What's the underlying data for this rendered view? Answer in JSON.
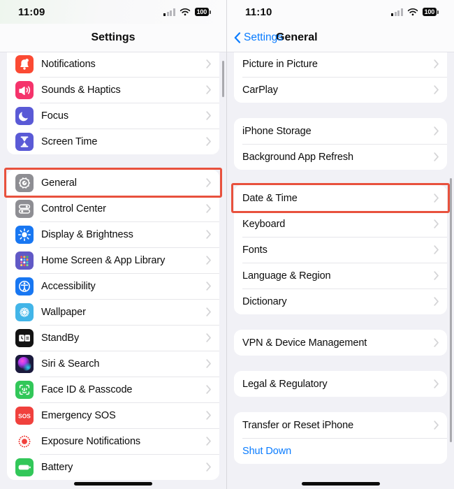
{
  "left": {
    "status": {
      "time": "11:09",
      "battery": "100",
      "signal_icon": "cellular-signal-icon",
      "wifi_icon": "wifi-icon",
      "battery_icon": "battery-icon"
    },
    "nav": {
      "title": "Settings"
    },
    "groups": [
      {
        "partial_top": true,
        "rows": [
          {
            "label": "Notifications",
            "icon": "notifications-icon",
            "color": "#fb4a33"
          },
          {
            "label": "Sounds & Haptics",
            "icon": "sounds-haptics-icon",
            "color": "#f5336b"
          },
          {
            "label": "Focus",
            "icon": "focus-icon",
            "color": "#5a5ad6"
          },
          {
            "label": "Screen Time",
            "icon": "screen-time-icon",
            "color": "#5a5ad6"
          }
        ]
      },
      {
        "rows": [
          {
            "label": "General",
            "icon": "general-gear-icon",
            "color": "#8e8e93",
            "highlighted": true
          },
          {
            "label": "Control Center",
            "icon": "control-center-icon",
            "color": "#8e8e93"
          },
          {
            "label": "Display & Brightness",
            "icon": "display-brightness-icon",
            "color": "#1877f2"
          },
          {
            "label": "Home Screen & App Library",
            "icon": "home-screen-icon",
            "color": "#6159c6"
          },
          {
            "label": "Accessibility",
            "icon": "accessibility-icon",
            "color": "#1877f2"
          },
          {
            "label": "Wallpaper",
            "icon": "wallpaper-icon",
            "color": "#42b5e8"
          },
          {
            "label": "StandBy",
            "icon": "standby-icon",
            "color": "#131313"
          },
          {
            "label": "Siri & Search",
            "icon": "siri-search-icon",
            "color": "#2a2050"
          },
          {
            "label": "Face ID & Passcode",
            "icon": "face-id-icon",
            "color": "#32c759"
          },
          {
            "label": "Emergency SOS",
            "icon": "emergency-sos-icon",
            "color": "#f0413d"
          },
          {
            "label": "Exposure Notifications",
            "icon": "exposure-notifications-icon",
            "color": "#ffffff"
          },
          {
            "label": "Battery",
            "icon": "battery-settings-icon",
            "color": "#32c759"
          }
        ]
      }
    ]
  },
  "right": {
    "status": {
      "time": "11:10",
      "battery": "100",
      "signal_icon": "cellular-signal-icon",
      "wifi_icon": "wifi-icon",
      "battery_icon": "battery-icon"
    },
    "nav": {
      "back_label": "Settings",
      "title": "General",
      "back_icon": "chevron-left-icon"
    },
    "groups": [
      {
        "partial_top": true,
        "rows": [
          {
            "label": "Picture in Picture"
          },
          {
            "label": "CarPlay"
          }
        ]
      },
      {
        "rows": [
          {
            "label": "iPhone Storage"
          },
          {
            "label": "Background App Refresh"
          }
        ]
      },
      {
        "rows": [
          {
            "label": "Date & Time",
            "highlighted": true
          },
          {
            "label": "Keyboard"
          },
          {
            "label": "Fonts"
          },
          {
            "label": "Language & Region"
          },
          {
            "label": "Dictionary"
          }
        ]
      },
      {
        "rows": [
          {
            "label": "VPN & Device Management"
          }
        ]
      },
      {
        "rows": [
          {
            "label": "Legal & Regulatory"
          }
        ]
      },
      {
        "rows": [
          {
            "label": "Transfer or Reset iPhone"
          },
          {
            "label": "Shut Down",
            "link": true,
            "no_chevron": true
          }
        ]
      }
    ]
  },
  "highlight_color": "#e8513d"
}
